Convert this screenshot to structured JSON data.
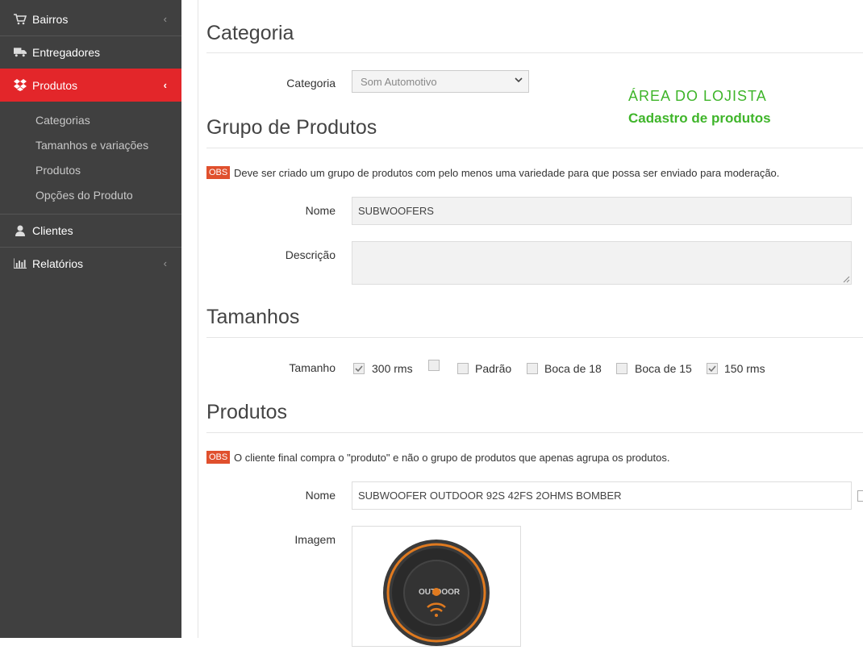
{
  "sidebar": {
    "items": [
      {
        "label": "Bairros",
        "icon": "shopping-cart-icon"
      },
      {
        "label": "Entregadores",
        "icon": "truck-icon"
      },
      {
        "label": "Produtos",
        "icon": "dropbox-icon"
      },
      {
        "label": "Clientes",
        "icon": "user-icon"
      },
      {
        "label": "Relatórios",
        "icon": "bar-chart-icon"
      }
    ],
    "subitems": [
      "Categorias",
      "Tamanhos e variações",
      "Produtos",
      "Opções do Produto"
    ],
    "active_color": "#e3262a"
  },
  "overlay": {
    "line1": "ÁREA DO LOJISTA",
    "line2": "Cadastro de produtos",
    "color": "#3fb52a"
  },
  "categoria": {
    "title": "Categoria",
    "label": "Categoria",
    "selected": "Som Automotivo"
  },
  "grupo": {
    "title": "Grupo de Produtos",
    "obs_badge": "OBS",
    "obs_text": "Deve ser criado um grupo de produtos com pelo menos uma variedade para que possa ser enviado para moderação.",
    "nome_label": "Nome",
    "nome_value": "SUBWOOFERS",
    "descricao_label": "Descrição",
    "descricao_value": ""
  },
  "tamanhos": {
    "title": "Tamanhos",
    "label": "Tamanho",
    "options": [
      {
        "label": "300 rms",
        "checked": true
      },
      {
        "label": "",
        "checked": false
      },
      {
        "label": "Padrão",
        "checked": false
      },
      {
        "label": "Boca de 18",
        "checked": false
      },
      {
        "label": "Boca de 15",
        "checked": false
      },
      {
        "label": "150 rms",
        "checked": true
      }
    ]
  },
  "produtos": {
    "title": "Produtos",
    "obs_badge": "OBS",
    "obs_text": "O cliente final compra o \"produto\" e não o grupo de produtos que apenas agrupa os produtos.",
    "nome_label": "Nome",
    "nome_value": "SUBWOOFER OUTDOOR 92S 42FS 2OHMS BOMBER",
    "imagem_label": "Imagem",
    "image_brand": "OUTDOOR"
  }
}
